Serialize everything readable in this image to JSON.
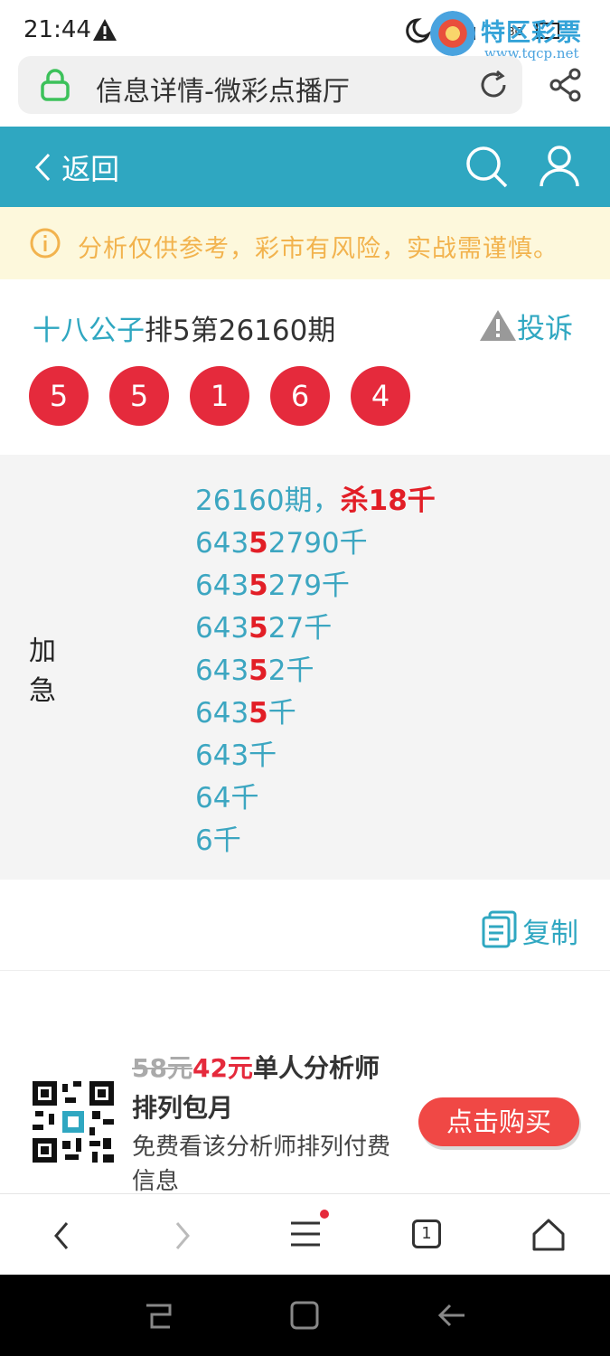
{
  "status_bar": {
    "time": "21:44"
  },
  "watermark": {
    "name": "特区彩票网",
    "url": "www.tqcp.net"
  },
  "url_bar": {
    "title": "信息详情-微彩点播厅"
  },
  "top_nav": {
    "back_label": "返回"
  },
  "notice": {
    "text": "分析仅供参考，彩市有风险，实战需谨慎。"
  },
  "post": {
    "author": "十八公子",
    "title_rest": "排5第26160期",
    "complain_label": "投诉",
    "balls": [
      "5",
      "5",
      "1",
      "6",
      "4"
    ],
    "tag": "加急",
    "lines": [
      {
        "a": "26160期，",
        "r": "杀18千",
        "b": ""
      },
      {
        "a": "643",
        "r": "5",
        "b": "2790千"
      },
      {
        "a": "643",
        "r": "5",
        "b": "279千"
      },
      {
        "a": "643",
        "r": "5",
        "b": "27千"
      },
      {
        "a": "643",
        "r": "5",
        "b": "2千"
      },
      {
        "a": "643",
        "r": "5",
        "b": "千"
      },
      {
        "a": "643千",
        "r": "",
        "b": ""
      },
      {
        "a": "64千",
        "r": "",
        "b": ""
      },
      {
        "a": "6千",
        "r": "",
        "b": ""
      }
    ],
    "copy_label": "复制"
  },
  "promo": {
    "old_price": "58元",
    "new_price": "42元",
    "title_rest": "单人分析师",
    "title_line2": "排列包月",
    "desc": "免费看该分析师排列付费信息",
    "buy_label": "点击购买"
  },
  "bottom_bar": {
    "tabs_count": "1"
  },
  "colors": {
    "accent": "#2fa7c1",
    "ball": "#e52a3c",
    "highlight": "#e21e26",
    "notice_text": "#f2b34e"
  }
}
